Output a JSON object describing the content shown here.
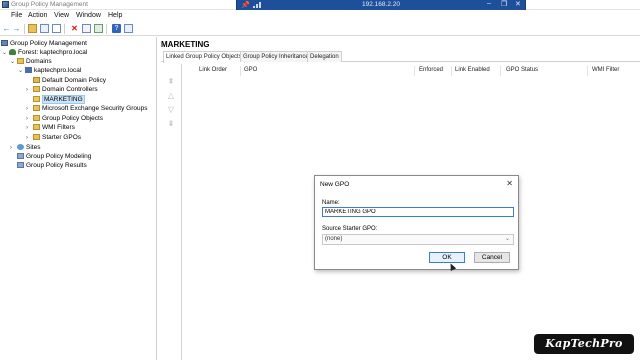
{
  "window": {
    "title": "Group Policy Management",
    "icon": "gpm-app-icon"
  },
  "remote_bar": {
    "host": "192.168.2.20",
    "pin_icon": "pin-icon",
    "signal_icon": "signal-bars-icon",
    "minimize": "–",
    "restore": "❐",
    "close": "✕"
  },
  "menu": {
    "items": [
      "File",
      "Action",
      "View",
      "Window",
      "Help"
    ]
  },
  "toolbar": {
    "icons": [
      "back-arrow-icon",
      "forward-arrow-icon",
      "up-folder-icon",
      "show-hide-tree-icon",
      "properties-icon",
      "delete-icon",
      "export-icon",
      "refresh-icon",
      "help-icon",
      "console-icon"
    ]
  },
  "tree": {
    "items": [
      {
        "label": "Group Policy Management",
        "icon": "gpm-icon"
      },
      {
        "label": "Forest: kaptechpro.local",
        "icon": "forest-icon",
        "expander": "⌄"
      },
      {
        "label": "Domains",
        "icon": "folder-icon",
        "expander": "⌄"
      },
      {
        "label": "kaptechpro.local",
        "icon": "domain-icon",
        "expander": "⌄"
      },
      {
        "label": "Default Domain Policy",
        "icon": "gpo-link-icon"
      },
      {
        "label": "Domain Controllers",
        "icon": "ou-icon",
        "expander": "›"
      },
      {
        "label": "MARKETING",
        "icon": "ou-icon",
        "expander": "",
        "selected": true
      },
      {
        "label": "Microsoft Exchange Security Groups",
        "icon": "ou-icon",
        "expander": "›"
      },
      {
        "label": "Group Policy Objects",
        "icon": "folder-icon",
        "expander": "›"
      },
      {
        "label": "WMI Filters",
        "icon": "folder-icon",
        "expander": "›"
      },
      {
        "label": "Starter GPOs",
        "icon": "folder-icon",
        "expander": "›"
      },
      {
        "label": "Sites",
        "icon": "sites-icon",
        "expander": "›"
      },
      {
        "label": "Group Policy Modeling",
        "icon": "modeling-icon"
      },
      {
        "label": "Group Policy Results",
        "icon": "results-icon"
      }
    ]
  },
  "pane": {
    "title": "MARKETING",
    "tabs": [
      "Linked Group Policy Objects",
      "Group Policy Inheritance",
      "Delegation"
    ],
    "columns": [
      "Link Order",
      "GPO",
      "Enforced",
      "Link Enabled",
      "GPO Status",
      "WMI Filter"
    ],
    "order_icons": [
      "move-top-icon",
      "move-up-icon",
      "move-down-icon",
      "move-bottom-icon"
    ]
  },
  "dialog": {
    "title": "New GPO",
    "close": "✕",
    "name_label": "Name:",
    "name_value": "MARKETING GPO",
    "starter_label": "Source Starter GPO:",
    "starter_value": "(none)",
    "ok": "OK",
    "cancel": "Cancel"
  },
  "watermark": "KapTechPro"
}
